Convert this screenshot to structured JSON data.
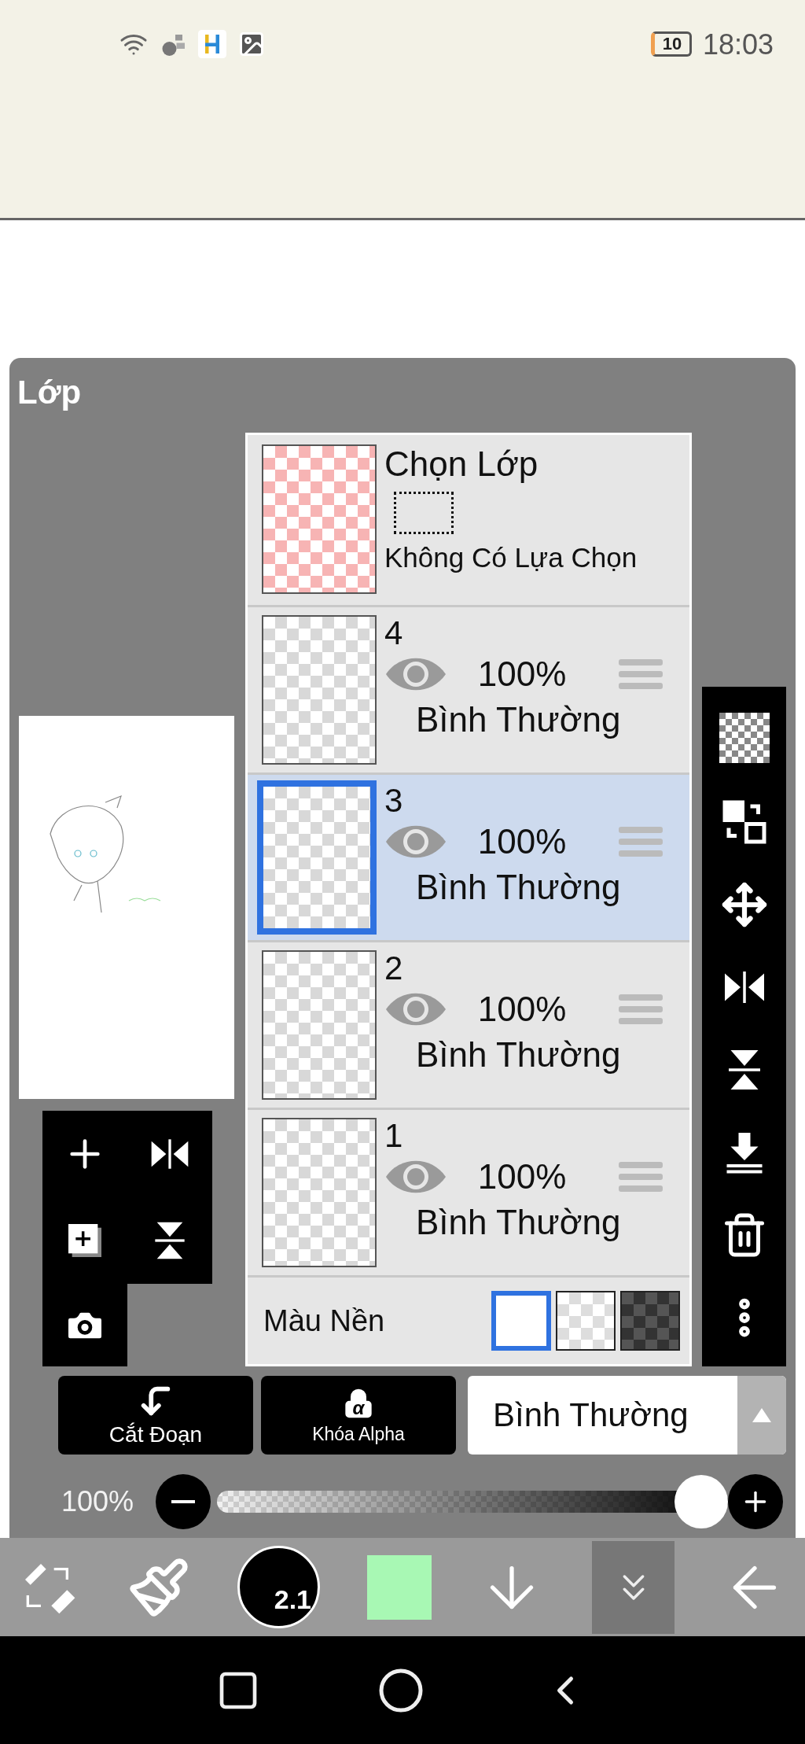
{
  "status_bar": {
    "battery": "10",
    "time": "18:03"
  },
  "panel": {
    "title": "Lớp"
  },
  "selection_layer": {
    "title": "Chọn Lớp",
    "status": "Không Có Lựa Chọn"
  },
  "layers": [
    {
      "name": "4",
      "visible": true,
      "opacity": "100%",
      "blend_mode": "Bình Thường",
      "selected": false
    },
    {
      "name": "3",
      "visible": true,
      "opacity": "100%",
      "blend_mode": "Bình Thường",
      "selected": true
    },
    {
      "name": "2",
      "visible": true,
      "opacity": "100%",
      "blend_mode": "Bình Thường",
      "selected": false
    },
    {
      "name": "1",
      "visible": true,
      "opacity": "100%",
      "blend_mode": "Bình Thường",
      "selected": false
    }
  ],
  "background_color": {
    "label": "Màu Nền",
    "options": [
      {
        "kind": "white",
        "selected": true
      },
      {
        "kind": "transparent",
        "selected": false
      },
      {
        "kind": "dark",
        "selected": false
      }
    ]
  },
  "layer_actions": [
    {
      "kind": "clipping",
      "label": "Cắt Đoạn"
    },
    {
      "kind": "alpha_lock",
      "label": "Khóa Alpha",
      "symbol": "α"
    }
  ],
  "blend_mode_select": {
    "value": "Bình Thường"
  },
  "opacity": {
    "reading": "100%",
    "level": 1
  },
  "toolbar": {
    "brush_size": "2.1",
    "color": "#a8f8b4"
  }
}
